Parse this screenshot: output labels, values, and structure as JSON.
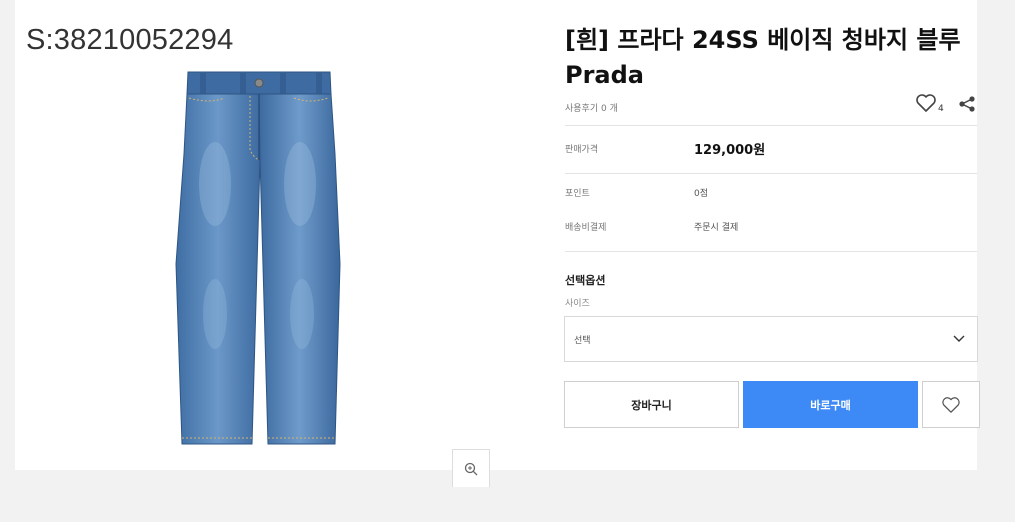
{
  "product": {
    "code": "S:38210052294",
    "title": "[흰] 프라다 24SS 베이직 청바지 블루 Prada",
    "review_count": "사용후기 0 개",
    "wish_count": "4",
    "image": "denim-jeans-image"
  },
  "info": {
    "price_label": "판매가격",
    "price_value": "129,000원",
    "point_label": "포인트",
    "point_value": "0점",
    "shipping_label": "배송비결제",
    "shipping_value": "주문시 결제"
  },
  "options": {
    "heading": "선택옵션",
    "size_label": "사이즈",
    "size_selected": "선택"
  },
  "buttons": {
    "cart_label": "장바구니",
    "buy_label": "바로구매"
  },
  "colors": {
    "buy_button": "#3d8af7",
    "denim": "#4f7fb3"
  }
}
